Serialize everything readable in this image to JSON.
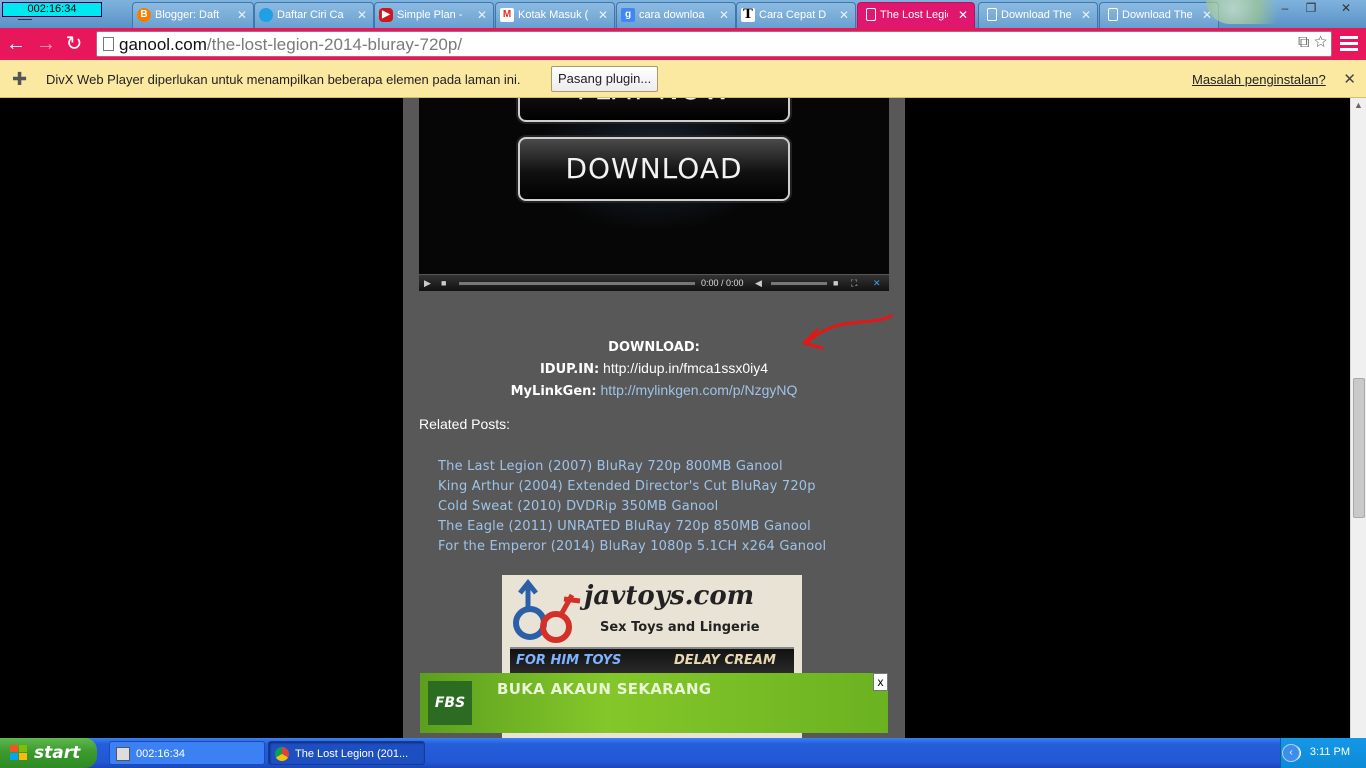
{
  "overlay_clock": "002:16:34",
  "tabs": [
    {
      "label": "Blogger: Daft",
      "icon": "blogger-icon",
      "color": "#f57d00"
    },
    {
      "label": "Daftar Ciri Ca",
      "icon": "globe-icon",
      "color": "#1ea0e6"
    },
    {
      "label": "Simple Plan - ",
      "icon": "youtube-icon",
      "color": "#cc181e"
    },
    {
      "label": "Kotak Masuk (",
      "icon": "gmail-icon",
      "color": "#d93025"
    },
    {
      "label": "cara downloa",
      "icon": "google-icon",
      "color": "#4285f4"
    },
    {
      "label": "Cara Cepat D",
      "icon": "t-letter-icon",
      "color": "#ffffff"
    },
    {
      "label": "The Lost Legio",
      "icon": "page-icon",
      "color": "#ffffff"
    },
    {
      "label": "Download The",
      "icon": "page-icon",
      "color": "#ffffff"
    },
    {
      "label": "Download The",
      "icon": "page-icon",
      "color": "#ffffff"
    }
  ],
  "active_tab_index": 6,
  "address": {
    "host": "ganool.com",
    "path": "/the-lost-legion-2014-bluray-720p/"
  },
  "infobar": {
    "message": "DivX Web Player diperlukan untuk menampilkan beberapa elemen pada laman ini.",
    "install_label": "Pasang plugin...",
    "help_link": "Masalah penginstalan?"
  },
  "player": {
    "play_label": "PLAY NOW",
    "download_label": "DOWNLOAD",
    "time": "0:00 / 0:00"
  },
  "downloads": {
    "heading": "DOWNLOAD:",
    "idup_label": "IDUP.IN:",
    "idup_url": "http://idup.in/fmca1ssx0iy4",
    "mylinkgen_label": "MyLinkGen:",
    "mylinkgen_url": "http://mylinkgen.com/p/NzgyNQ"
  },
  "related": {
    "title": "Related Posts:",
    "items": [
      "The Last Legion (2007) BluRay 720p 800MB Ganool",
      "King Arthur (2004) Extended Director's Cut BluRay 720p",
      "Cold Sweat (2010) DVDRip 350MB Ganool",
      "The Eagle (2011) UNRATED BluRay 720p 850MB Ganool",
      "For the Emperor (2014) BluRay 1080p 5.1CH x264 Ganool"
    ]
  },
  "ad": {
    "brand": "javtoys.com",
    "tagline": "Sex Toys and Lingerie",
    "strip_left": "FOR HIM TOYS",
    "strip_right": "DELAY CREAM"
  },
  "fbs_ad": {
    "logo": "FBS",
    "text": "BUKA AKAUN SEKARANG",
    "close": "x"
  },
  "taskbar": {
    "start_label": "start",
    "tasks": [
      {
        "label": "002:16:34"
      },
      {
        "label": "The Lost Legion (201..."
      }
    ],
    "time": "3:11 PM"
  },
  "colors": {
    "chrome_accent": "#e8175b",
    "taskbar_blue": "#245edb",
    "link_blue": "#9fc3e8"
  }
}
